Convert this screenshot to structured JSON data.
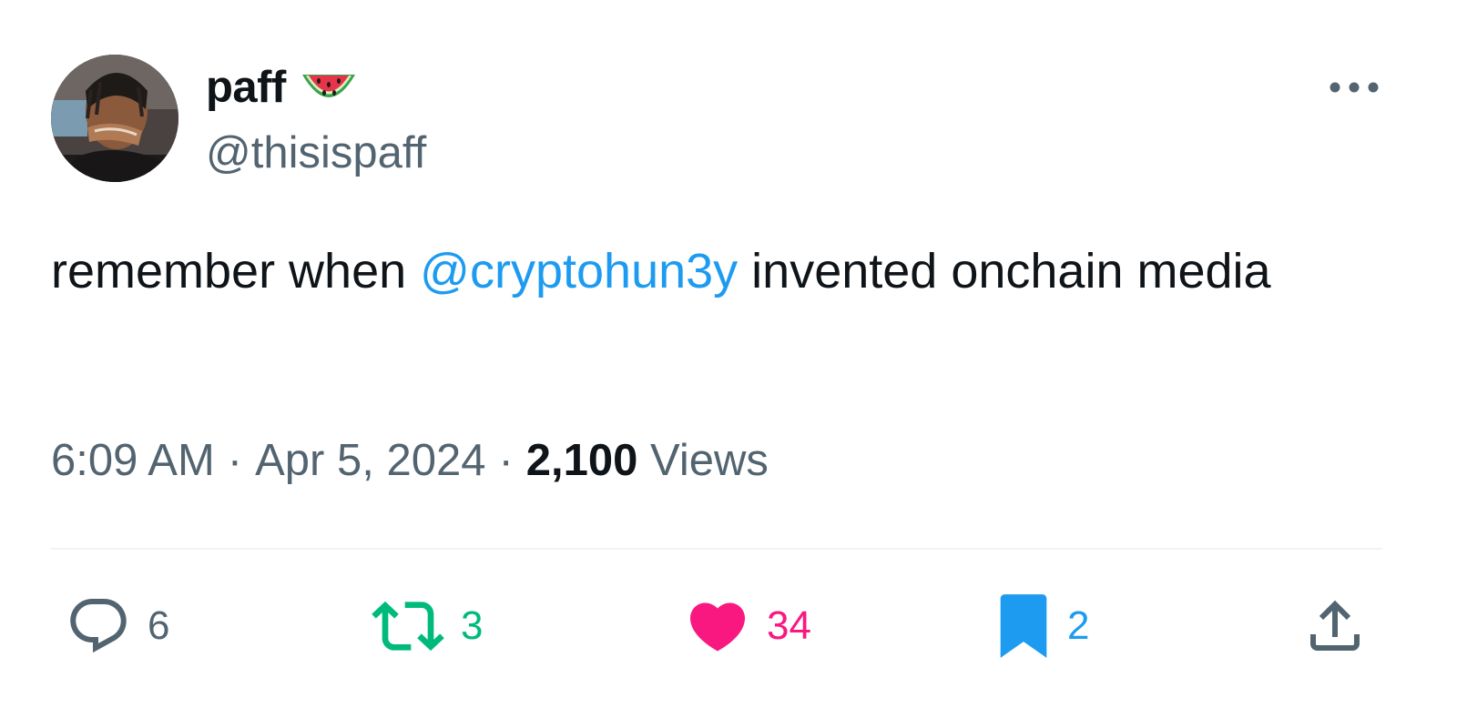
{
  "author": {
    "display_name": "paff",
    "handle": "@thisispaff",
    "badge_icon": "watermelon-emoji",
    "avatar_icon": "profile-photo"
  },
  "tweet": {
    "text_before": "remember when ",
    "mention": "@cryptohun3y",
    "text_after": " invented onchain media"
  },
  "meta": {
    "time": "6:09 AM",
    "separator": "·",
    "date": "Apr 5, 2024",
    "views_count": "2,100",
    "views_label": "Views"
  },
  "actions": {
    "reply_count": "6",
    "retweet_count": "3",
    "like_count": "34",
    "bookmark_count": "2"
  },
  "colors": {
    "text_primary": "#0f1419",
    "text_secondary": "#536471",
    "mention": "#1d9bf0",
    "retweet": "#00ba7c",
    "like": "#f91880",
    "bookmark": "#1d9bf0",
    "divider": "#eff3f4"
  }
}
